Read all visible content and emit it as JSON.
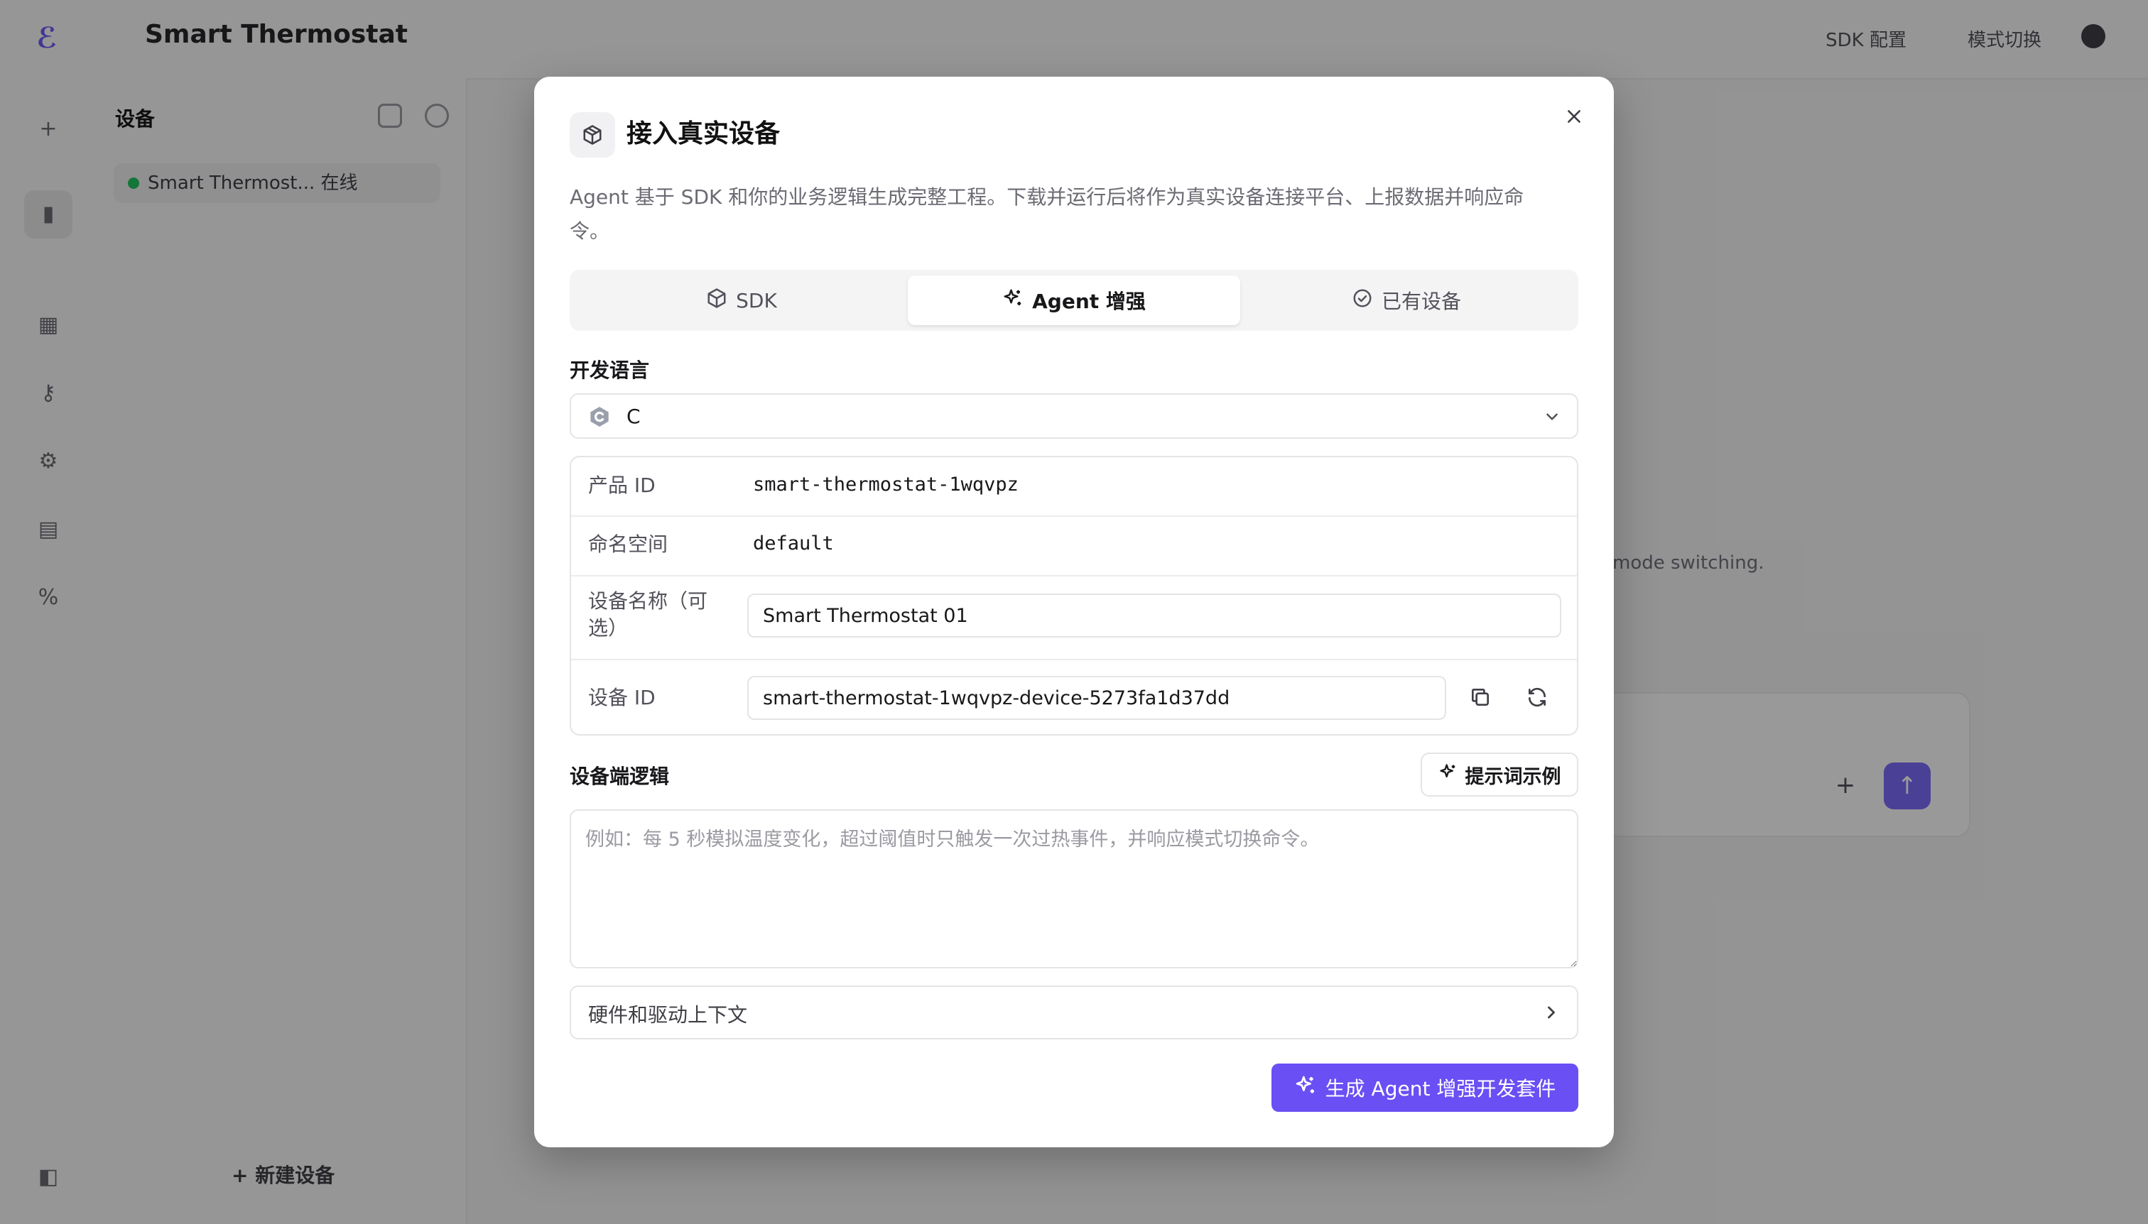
{
  "app": {
    "title": "Smart Thermostat",
    "topbar_chip_1": "SDK 配置",
    "topbar_chip_2": "模式切换",
    "sidebar": {
      "header": "设备",
      "device_item": "Smart Thermost... 在线",
      "add_label": "+ 新建设备"
    },
    "hint_text": "mode switching."
  },
  "modal": {
    "title": "接入真实设备",
    "description": "Agent 基于 SDK 和你的业务逻辑生成完整工程。下载并运行后将作为真实设备连接平台、上报数据并响应命令。",
    "tabs": [
      {
        "label": "SDK",
        "icon": "package-icon",
        "active": false
      },
      {
        "label": "Agent 增强",
        "icon": "sparkles-icon",
        "active": true
      },
      {
        "label": "已有设备",
        "icon": "check-circle-icon",
        "active": false
      }
    ],
    "language": {
      "label": "开发语言",
      "value": "C",
      "icon": "c-language-icon"
    },
    "details": {
      "product_id_label": "产品 ID",
      "product_id": "smart-thermostat-1wqvpz",
      "namespace_label": "命名空间",
      "namespace": "default",
      "device_name_label": "设备名称（可选）",
      "device_name": "Smart Thermostat 01",
      "device_id_label": "设备 ID",
      "device_id": "smart-thermostat-1wqvpz-device-5273fa1d37dd"
    },
    "logic": {
      "label": "设备端逻辑",
      "prompt_button": "提示词示例",
      "placeholder": "例如：每 5 秒模拟温度变化，超过阈值时只触发一次过热事件，并响应模式切换命令。"
    },
    "context_label": "硬件和驱动上下文",
    "generate_button": "生成 Agent 增强开发套件",
    "colors": {
      "accent": "#6a4ff4",
      "border": "#e4e4e7"
    }
  }
}
